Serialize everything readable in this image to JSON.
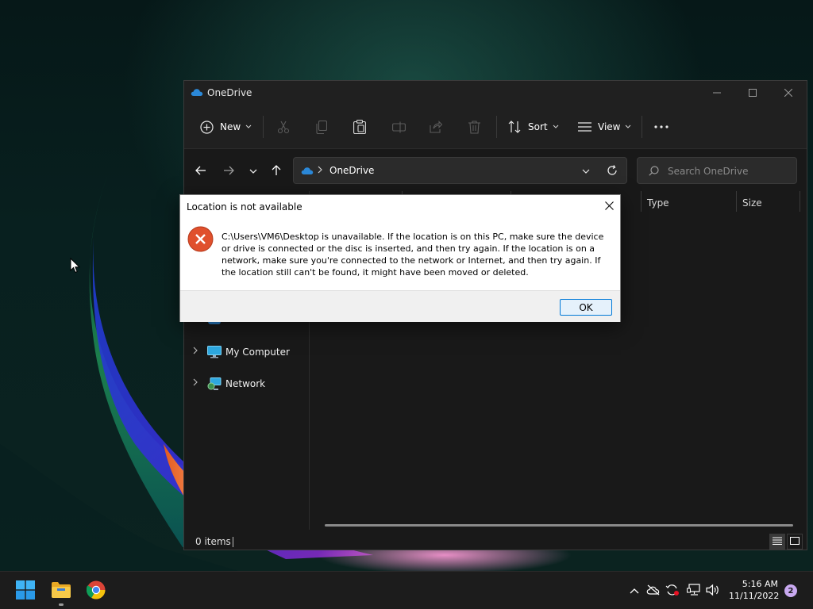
{
  "explorer": {
    "title": "OneDrive",
    "toolbar": {
      "new_label": "New",
      "sort_label": "Sort",
      "view_label": "View"
    },
    "address": {
      "location": "OneDrive"
    },
    "search": {
      "placeholder": "Search OneDrive"
    },
    "columns": {
      "type": "Type",
      "size": "Size"
    },
    "sidebar": {
      "items": [
        {
          "label": "My Computer",
          "icon": "computer-icon"
        },
        {
          "label": "Network",
          "icon": "network-icon"
        }
      ]
    },
    "status": {
      "item_count": "0 items"
    }
  },
  "dialog": {
    "title": "Location is not available",
    "message": "C:\\Users\\VM6\\Desktop is unavailable. If the location is on this PC, make sure the device or drive is connected or the disc is inserted, and then try again. If the location is on a network, make sure you're connected to the network or Internet, and then try again. If the location still can't be found, it might have been moved or deleted.",
    "ok_label": "OK",
    "icon": "error-icon"
  },
  "taskbar": {
    "time": "5:16 AM",
    "date": "11/11/2022",
    "notification_count": "2"
  },
  "colors": {
    "accent": "#0078d7",
    "error": "#e0502d",
    "onedrive_blue": "#2b88d8"
  }
}
